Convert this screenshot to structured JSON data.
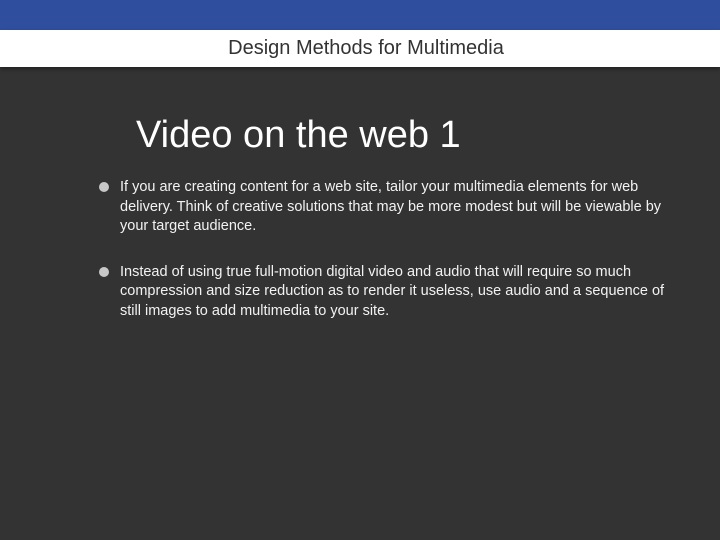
{
  "header": {
    "title": "Design Methods for Multimedia"
  },
  "slide": {
    "title": "Video on the web 1",
    "bullets": [
      "If you are creating content for a web site, tailor your multimedia elements for web delivery. Think of creative solutions that may be more modest but will be viewable by your target audience.",
      "Instead of using true full-motion digital video and audio that will require so much compression and size reduction as to render it useless, use audio and a sequence of still  images to add multimedia to your site."
    ]
  },
  "colors": {
    "top_bar": "#2f4f9e",
    "header_band": "#ffffff",
    "background": "#333333",
    "text": "#f2f2f2",
    "bullet": "#c8c8c8"
  }
}
